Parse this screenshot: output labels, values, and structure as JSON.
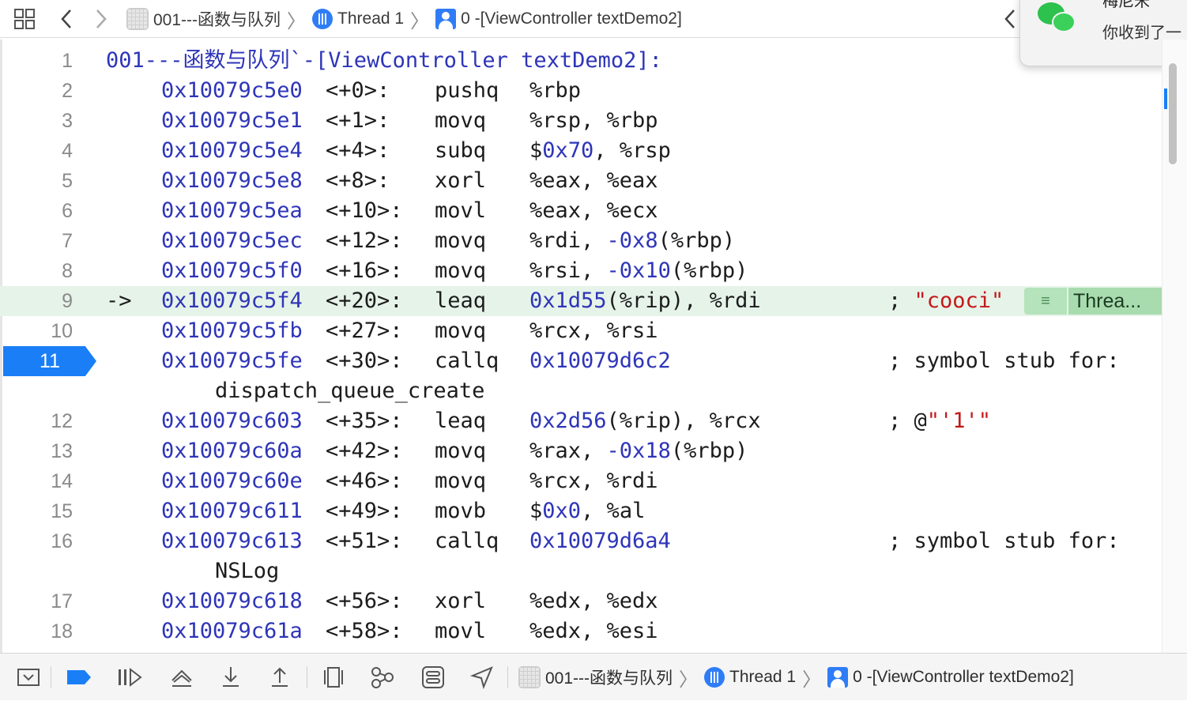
{
  "top_bar": {
    "breadcrumbs": [
      {
        "label": "001---函数与队列",
        "icon": "file-icon"
      },
      {
        "label": "Thread 1",
        "icon": "thread-icon"
      },
      {
        "label": "0 -[ViewController textDemo2]",
        "icon": "stack-frame-icon"
      }
    ]
  },
  "notification": {
    "app_icon": "wechat-icon",
    "title": "梅尼米",
    "message": "你收到了一"
  },
  "code": {
    "lines": [
      {
        "n": "1",
        "header": "001---函数与队列`-[ViewController textDemo2]:"
      },
      {
        "n": "2",
        "addr": "0x10079c5e0",
        "off": "<+0>:",
        "op": "pushq",
        "args": [
          {
            "t": "%rbp"
          }
        ]
      },
      {
        "n": "3",
        "addr": "0x10079c5e1",
        "off": "<+1>:",
        "op": "movq",
        "args": [
          {
            "t": "%rsp, %rbp"
          }
        ]
      },
      {
        "n": "4",
        "addr": "0x10079c5e4",
        "off": "<+4>:",
        "op": "subq",
        "args": [
          {
            "t": "$"
          },
          {
            "t": "0x70",
            "k": "num"
          },
          {
            "t": ", %rsp"
          }
        ]
      },
      {
        "n": "5",
        "addr": "0x10079c5e8",
        "off": "<+8>:",
        "op": "xorl",
        "args": [
          {
            "t": "%eax, %eax"
          }
        ]
      },
      {
        "n": "6",
        "addr": "0x10079c5ea",
        "off": "<+10>:",
        "op": "movl",
        "args": [
          {
            "t": "%eax, %ecx"
          }
        ]
      },
      {
        "n": "7",
        "addr": "0x10079c5ec",
        "off": "<+12>:",
        "op": "movq",
        "args": [
          {
            "t": "%rdi, "
          },
          {
            "t": "-0x8",
            "k": "num"
          },
          {
            "t": "(%rbp)"
          }
        ]
      },
      {
        "n": "8",
        "addr": "0x10079c5f0",
        "off": "<+16>:",
        "op": "movq",
        "args": [
          {
            "t": "%rsi, "
          },
          {
            "t": "-0x10",
            "k": "num"
          },
          {
            "t": "(%rbp)"
          }
        ]
      },
      {
        "n": "9",
        "arrow": "->",
        "addr": "0x10079c5f4",
        "off": "<+20>:",
        "op": "leaq",
        "args": [
          {
            "t": "0x1d55",
            "k": "num"
          },
          {
            "t": "(%rip), %rdi"
          }
        ],
        "comment": [
          {
            "t": "; "
          },
          {
            "t": "\"cooci\"",
            "k": "str"
          }
        ],
        "current": true
      },
      {
        "n": "10",
        "addr": "0x10079c5fb",
        "off": "<+27>:",
        "op": "movq",
        "args": [
          {
            "t": "%rcx, %rsi"
          }
        ]
      },
      {
        "n": "11",
        "addr": "0x10079c5fe",
        "off": "<+30>:",
        "op": "callq",
        "args": [
          {
            "t": "0x10079d6c2",
            "k": "num"
          }
        ],
        "comment": [
          {
            "t": "; symbol stub for:"
          }
        ],
        "breakpoint": true
      },
      {
        "cont": "dispatch_queue_create"
      },
      {
        "n": "12",
        "addr": "0x10079c603",
        "off": "<+35>:",
        "op": "leaq",
        "args": [
          {
            "t": "0x2d56",
            "k": "num"
          },
          {
            "t": "(%rip), %rcx"
          }
        ],
        "comment": [
          {
            "t": "; @"
          },
          {
            "t": "\"'1'\"",
            "k": "str"
          }
        ]
      },
      {
        "n": "13",
        "addr": "0x10079c60a",
        "off": "<+42>:",
        "op": "movq",
        "args": [
          {
            "t": "%rax, "
          },
          {
            "t": "-0x18",
            "k": "num"
          },
          {
            "t": "(%rbp)"
          }
        ]
      },
      {
        "n": "14",
        "addr": "0x10079c60e",
        "off": "<+46>:",
        "op": "movq",
        "args": [
          {
            "t": "%rcx, %rdi"
          }
        ]
      },
      {
        "n": "15",
        "addr": "0x10079c611",
        "off": "<+49>:",
        "op": "movb",
        "args": [
          {
            "t": "$"
          },
          {
            "t": "0x0",
            "k": "num"
          },
          {
            "t": ", %al"
          }
        ]
      },
      {
        "n": "16",
        "addr": "0x10079c613",
        "off": "<+51>:",
        "op": "callq",
        "args": [
          {
            "t": "0x10079d6a4",
            "k": "num"
          }
        ],
        "comment": [
          {
            "t": "; symbol stub for:"
          }
        ]
      },
      {
        "cont": "NSLog"
      },
      {
        "n": "17",
        "addr": "0x10079c618",
        "off": "<+56>:",
        "op": "xorl",
        "args": [
          {
            "t": "%edx, %edx"
          }
        ]
      },
      {
        "n": "18",
        "addr": "0x10079c61a",
        "off": "<+58>:",
        "op": "movl",
        "args": [
          {
            "t": "%edx, %esi"
          }
        ]
      }
    ],
    "annotation_label": "Threa..."
  },
  "bottom_bar": {
    "breadcrumbs": [
      {
        "label": "001---函数与队列",
        "icon": "file-icon"
      },
      {
        "label": "Thread 1",
        "icon": "thread-icon"
      },
      {
        "label": "0 -[ViewController textDemo2]",
        "icon": "stack-frame-icon"
      }
    ]
  },
  "colors": {
    "address": "#2e35b8",
    "string": "#c4181a",
    "breakpoint": "#1a7ff7",
    "current_line": "#e6f3e9",
    "annotation": "#a8dcae"
  }
}
